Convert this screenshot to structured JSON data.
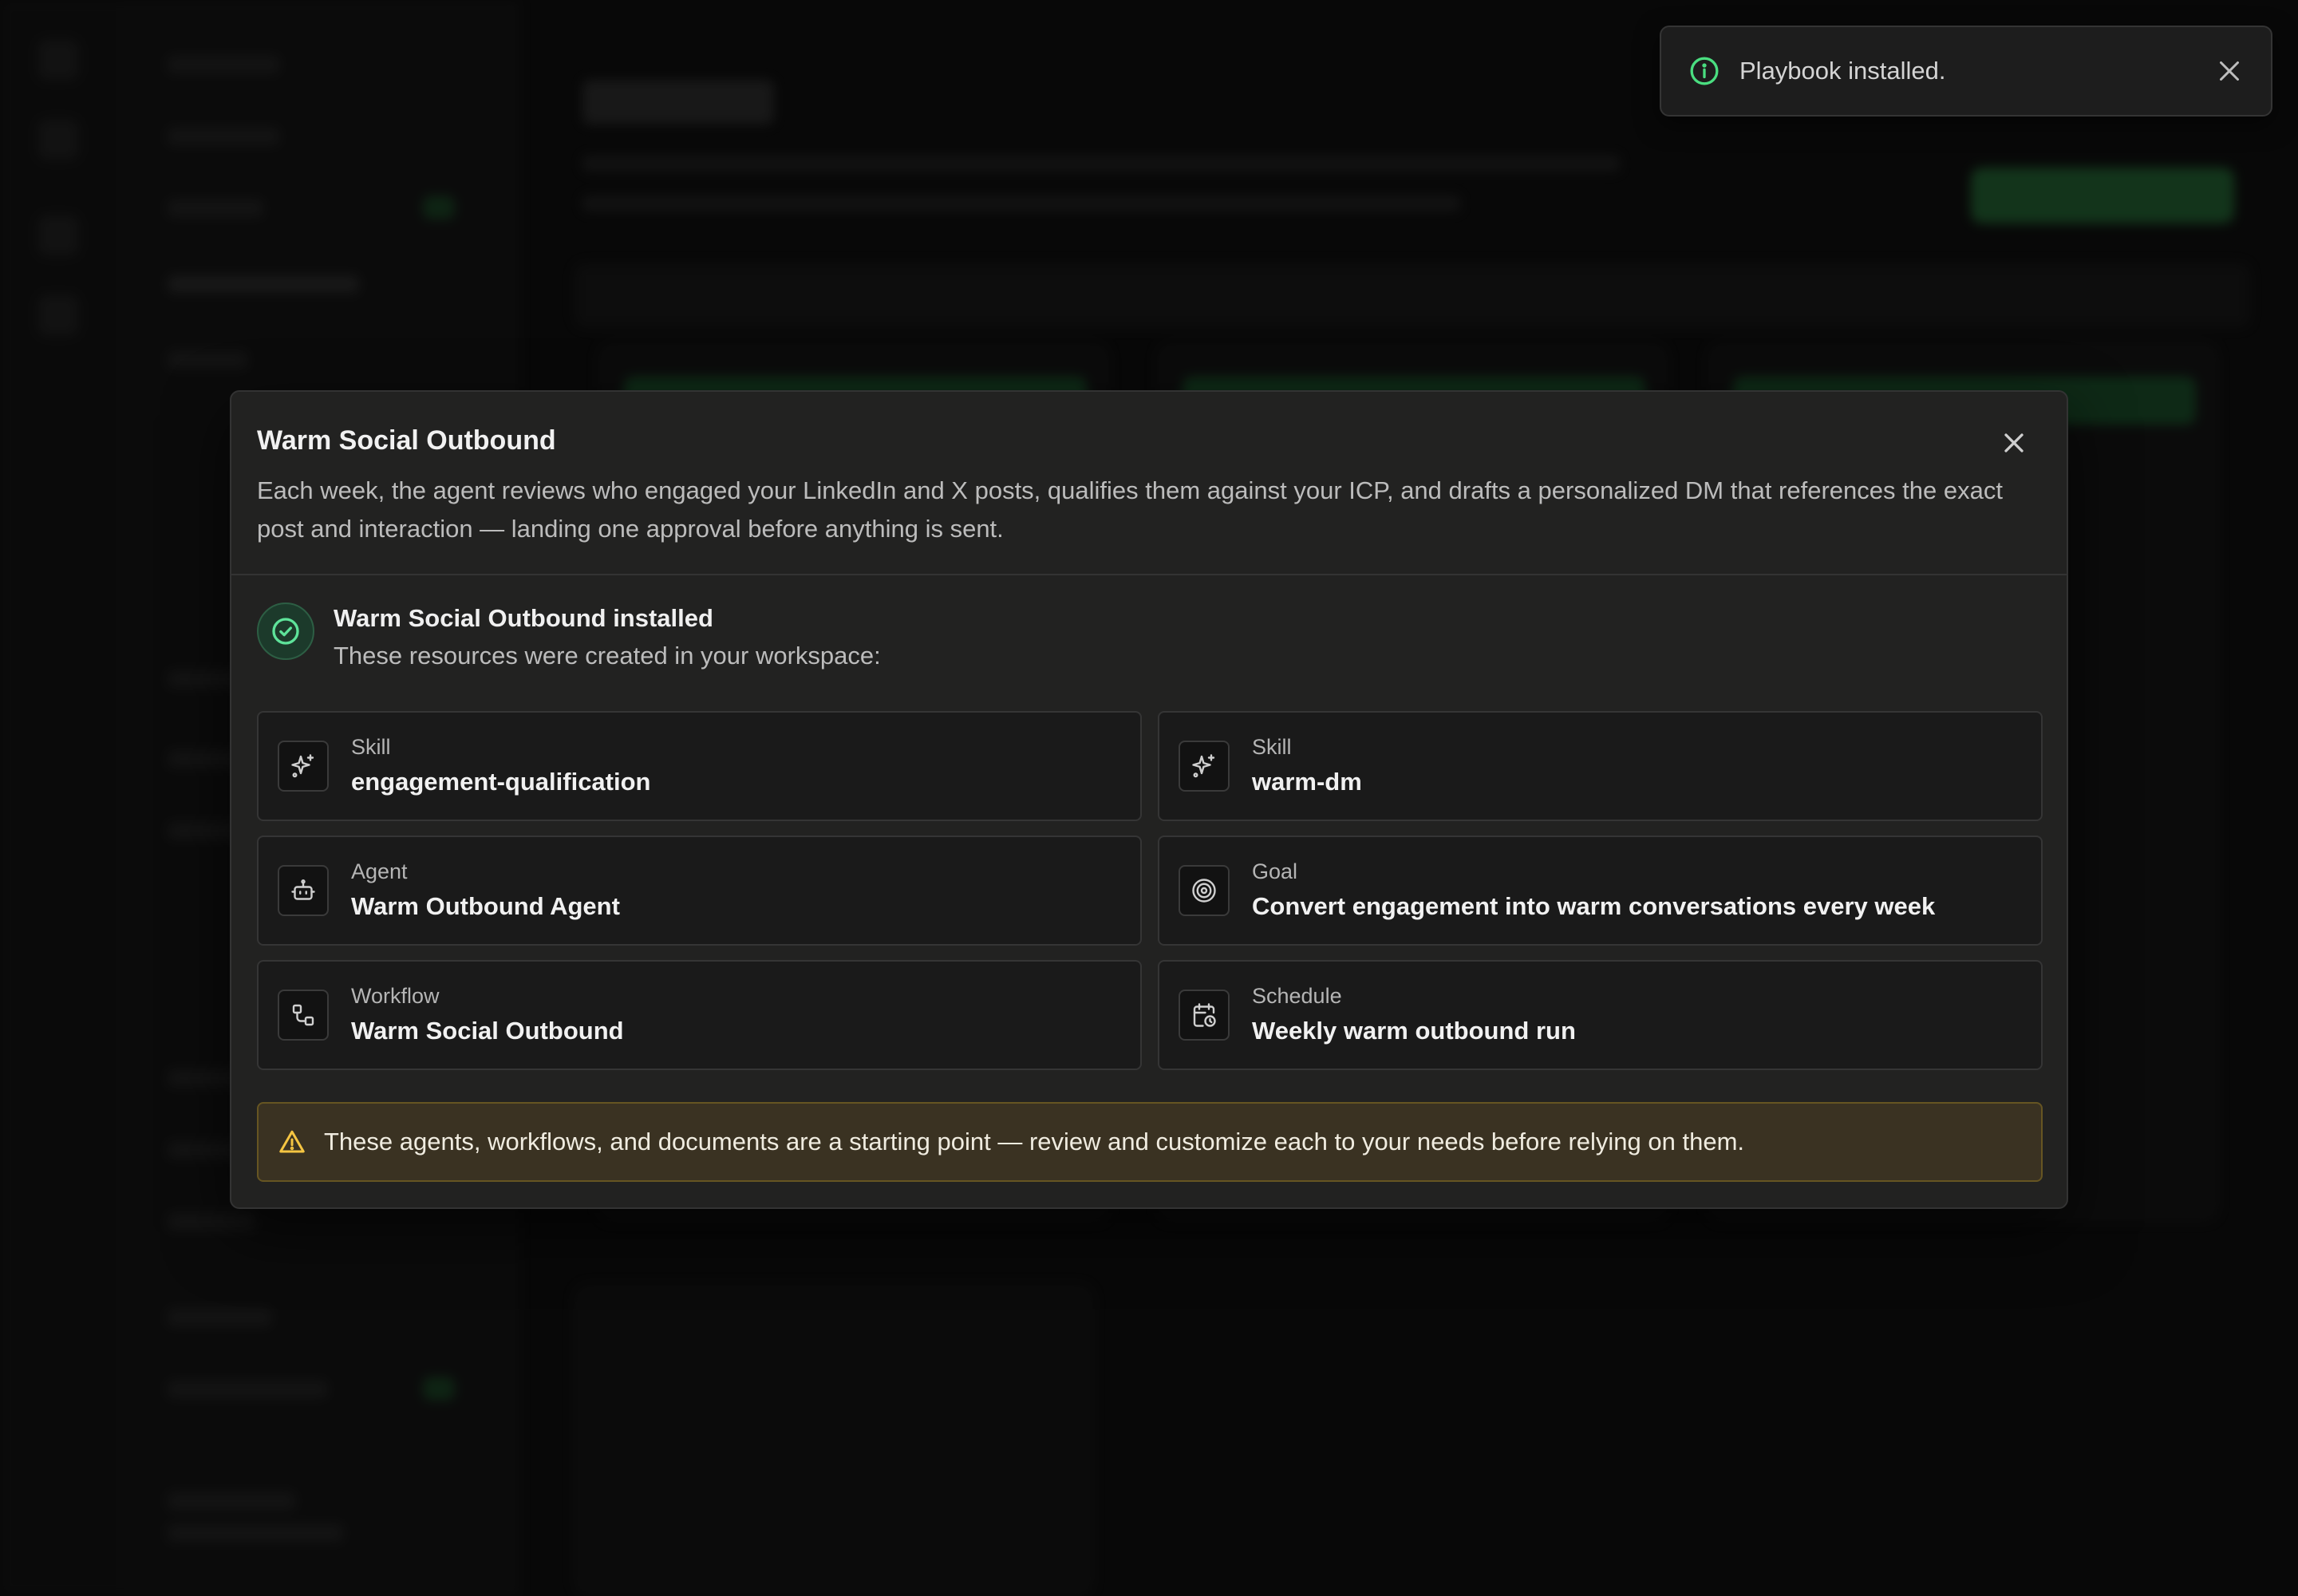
{
  "toast": {
    "message": "Playbook installed.",
    "info_icon": "info-icon",
    "close_icon": "close-icon"
  },
  "modal": {
    "title": "Warm Social Outbound",
    "description": "Each week, the agent reviews who engaged your LinkedIn and X posts, qualifies them against your ICP, and drafts a personalized DM that references the exact post and interaction — landing one approval before anything is sent.",
    "close_icon": "close-icon",
    "success": {
      "title": "Warm Social Outbound installed",
      "subtitle": "These resources were created in your workspace:",
      "icon": "check-circle-icon"
    },
    "resources": [
      {
        "type": "Skill",
        "name": "engagement-qualification",
        "icon": "sparkles-icon"
      },
      {
        "type": "Skill",
        "name": "warm-dm",
        "icon": "sparkles-icon"
      },
      {
        "type": "Agent",
        "name": "Warm Outbound Agent",
        "icon": "bot-icon"
      },
      {
        "type": "Goal",
        "name": "Convert engagement into warm conversations every week",
        "icon": "target-icon"
      },
      {
        "type": "Workflow",
        "name": "Warm Social Outbound",
        "icon": "workflow-icon"
      },
      {
        "type": "Schedule",
        "name": "Weekly warm outbound run",
        "icon": "calendar-clock-icon"
      }
    ],
    "warning": {
      "text": "These agents, workflows, and documents are a starting point — review and customize each to your needs before relying on them.",
      "icon": "warning-triangle-icon"
    }
  },
  "colors": {
    "accent_green": "#4ade80",
    "warning_yellow": "#f5c542",
    "modal_bg": "#222221",
    "card_bg": "#1a1a1a"
  }
}
